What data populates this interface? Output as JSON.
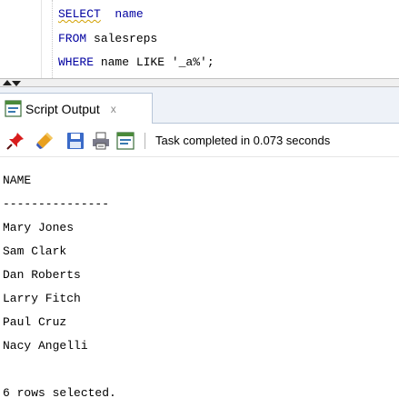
{
  "editor": {
    "lines": [
      {
        "keyword": "SELECT",
        "rest": "  name"
      },
      {
        "keyword": "FROM",
        "rest": " salesreps"
      },
      {
        "keyword": "WHERE",
        "rest": " name LIKE '_a%';"
      }
    ]
  },
  "tab": {
    "label": "Script Output",
    "close": "x",
    "icon": "script-output-icon"
  },
  "toolbar": {
    "icons": [
      "pin-icon",
      "eraser-icon",
      "save-icon",
      "print-icon",
      "run-script-icon"
    ],
    "status": "Task completed in 0.073 seconds"
  },
  "output": {
    "header": "NAME",
    "separator": "---------------",
    "rows": [
      "Mary Jones",
      "Sam Clark",
      "Dan Roberts",
      "Larry Fitch",
      "Paul Cruz",
      "Nacy Angelli"
    ],
    "footer": "6 rows selected."
  },
  "colors": {
    "keyword": "#0000a0",
    "tab_strip": "#eef2f8",
    "tab_border": "#b8c6d8"
  }
}
